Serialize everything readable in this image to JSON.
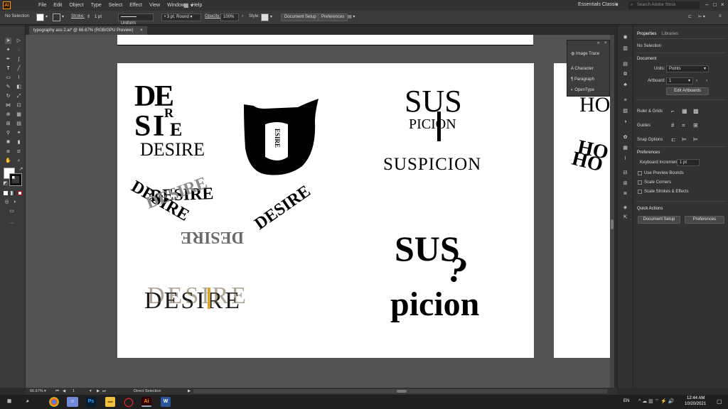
{
  "app": {
    "logo": "Ai",
    "workspace": "Essentials Classic",
    "search_placeholder": "Search Adobe Stock"
  },
  "menu": [
    "File",
    "Edit",
    "Object",
    "Type",
    "Select",
    "Effect",
    "View",
    "Window",
    "Help"
  ],
  "controlbar": {
    "selection": "No Selection",
    "stroke_label": "Stroke:",
    "stroke_value": "1 pt",
    "stroke_profile": "Uniform",
    "brush": "3 pt. Round",
    "opacity_label": "Opacity:",
    "opacity_value": "100%",
    "style_label": "Style:",
    "document_setup": "Document Setup",
    "preferences": "Preferences"
  },
  "document_tab": {
    "title": "typography ass 2.ai* @ 66.67% (RGB/GPU Preview)",
    "close": "×"
  },
  "artwork": {
    "desire_plain": "DESIRE",
    "desire_stack": [
      "D",
      "E",
      "S",
      "I",
      "R",
      "E"
    ],
    "desire_vertical": "ESIRE",
    "desire_wreath": "DESIRE",
    "desire_overlap": "DESIRE",
    "suspicion_plain": "SUSPICION",
    "sus_top": "SUS",
    "picion_bottom": "PICION",
    "sus_bold": "SUS",
    "picion_bold": "picion",
    "question": "?",
    "right_art": "HO"
  },
  "float_panel": {
    "items": [
      "Image Trace",
      "Character",
      "Paragraph",
      "OpenType"
    ]
  },
  "properties": {
    "tabs": [
      "Properties",
      "Libraries"
    ],
    "no_selection": "No Selection",
    "document_header": "Document",
    "units_label": "Units:",
    "units_value": "Points",
    "artboard_label": "Artboard:",
    "artboard_value": "1",
    "edit_artboards": "Edit Artboards",
    "rulers_grids": "Ruler & Grids",
    "guides": "Guides",
    "snap_options": "Snap Options",
    "preferences_header": "Preferences",
    "keyboard_increment_label": "Keyboard Increment:",
    "keyboard_increment_value": "1 pt",
    "use_preview_bounds": "Use Preview Bounds",
    "scale_corners": "Scale Corners",
    "scale_strokes": "Scale Strokes & Effects",
    "quick_actions": "Quick Actions",
    "document_setup_btn": "Document Setup",
    "preferences_btn": "Preferences"
  },
  "statusbar": {
    "zoom": "66.67%",
    "artboard": "1",
    "tool": "Direct Selection"
  },
  "taskbar": {
    "lang": "EN",
    "time": "12:44 AM",
    "date": "10/20/2021"
  },
  "colors": {
    "accent": "#ff9a00",
    "ui_dark": "#323232",
    "canvas": "#535353",
    "artboard": "#ffffff",
    "gold": "#d4a62a"
  }
}
